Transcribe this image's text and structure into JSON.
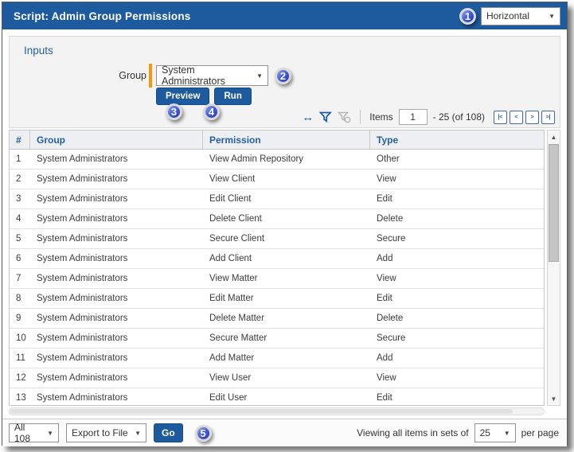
{
  "titlebar": {
    "title": "Script: Admin Group Permissions",
    "layout_dropdown": {
      "value": "Horizontal"
    }
  },
  "callouts": {
    "one": "1",
    "two": "2",
    "three": "3",
    "four": "4",
    "five": "5"
  },
  "inputs": {
    "heading": "Inputs",
    "group_label": "Group",
    "group_dropdown": {
      "value": "System Administrators"
    },
    "preview_button": "Preview",
    "run_button": "Run"
  },
  "toolbar": {
    "expand_icon": "↔",
    "items_label": "Items",
    "items_value": "1",
    "items_range": "- 25 (of 108)",
    "pager": {
      "first": "|<",
      "prev": "<",
      "next": ">",
      "last": ">|"
    }
  },
  "table": {
    "columns": [
      "#",
      "Group",
      "Permission",
      "Type"
    ],
    "rows": [
      {
        "num": "1",
        "group": "System Administrators",
        "permission": "View Admin Repository",
        "type": "Other"
      },
      {
        "num": "2",
        "group": "System Administrators",
        "permission": "View Client",
        "type": "View"
      },
      {
        "num": "3",
        "group": "System Administrators",
        "permission": "Edit Client",
        "type": "Edit"
      },
      {
        "num": "4",
        "group": "System Administrators",
        "permission": "Delete Client",
        "type": "Delete"
      },
      {
        "num": "5",
        "group": "System Administrators",
        "permission": "Secure Client",
        "type": "Secure"
      },
      {
        "num": "6",
        "group": "System Administrators",
        "permission": "Add Client",
        "type": "Add"
      },
      {
        "num": "7",
        "group": "System Administrators",
        "permission": "View Matter",
        "type": "View"
      },
      {
        "num": "8",
        "group": "System Administrators",
        "permission": "Edit Matter",
        "type": "Edit"
      },
      {
        "num": "9",
        "group": "System Administrators",
        "permission": "Delete Matter",
        "type": "Delete"
      },
      {
        "num": "10",
        "group": "System Administrators",
        "permission": "Secure Matter",
        "type": "Secure"
      },
      {
        "num": "11",
        "group": "System Administrators",
        "permission": "Add Matter",
        "type": "Add"
      },
      {
        "num": "12",
        "group": "System Administrators",
        "permission": "View User",
        "type": "View"
      },
      {
        "num": "13",
        "group": "System Administrators",
        "permission": "Edit User",
        "type": "Edit"
      }
    ]
  },
  "footer": {
    "range_dropdown": {
      "value": "All 108"
    },
    "export_dropdown": {
      "value": "Export to File"
    },
    "go_button": "Go",
    "viewing_prefix": "Viewing all items in sets of",
    "per_page_dropdown": {
      "value": "25"
    },
    "viewing_suffix": "per page"
  },
  "icons": {
    "dropdown_arrow": "▼",
    "scroll_up": "▲",
    "scroll_down": "▼"
  },
  "colors": {
    "titlebar_blue": "#1e5b9e",
    "button_blue": "#1d5a9e",
    "header_text_blue": "#2460a5",
    "required_orange": "#f5980c",
    "callout_blue": "#2f4cc4"
  }
}
